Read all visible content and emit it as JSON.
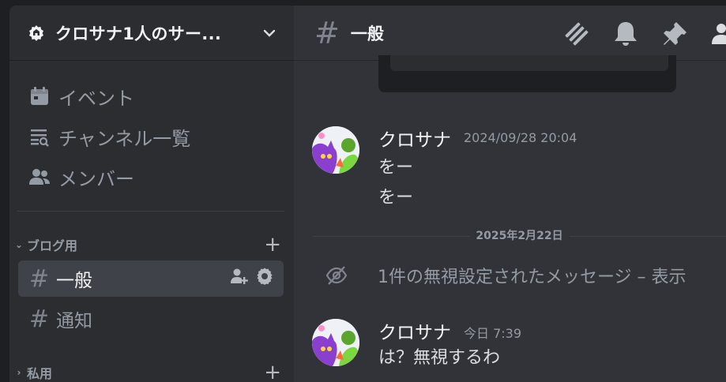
{
  "server": {
    "name": "クロサナ1人のサー..."
  },
  "nav": {
    "events": "イベント",
    "channel_list": "チャンネル一覧",
    "members": "メンバー"
  },
  "categories": [
    {
      "name": "ブログ用",
      "caret": "⌄"
    },
    {
      "name": "私用",
      "caret": "›"
    }
  ],
  "channels": [
    {
      "hash": "#",
      "name": "一般",
      "active": true
    },
    {
      "hash": "#",
      "name": "通知",
      "active": false
    }
  ],
  "header": {
    "hash": "#",
    "channel_name": "一般"
  },
  "messages": [
    {
      "author": "クロサナ",
      "timestamp": "2024/09/28 20:04",
      "lines": [
        "をー",
        "をー"
      ]
    },
    {
      "author": "クロサナ",
      "timestamp": "今日 7:39",
      "lines": [
        "は？無視するわ"
      ]
    }
  ],
  "date_separator": "2025年2月22日",
  "ignored_message": "1件の無視設定されたメッセージ – 表示",
  "colors": {
    "sidebar_bg": "#2b2d31",
    "main_bg": "#313338",
    "active_channel": "#404249",
    "muted_text": "#949ba4"
  }
}
